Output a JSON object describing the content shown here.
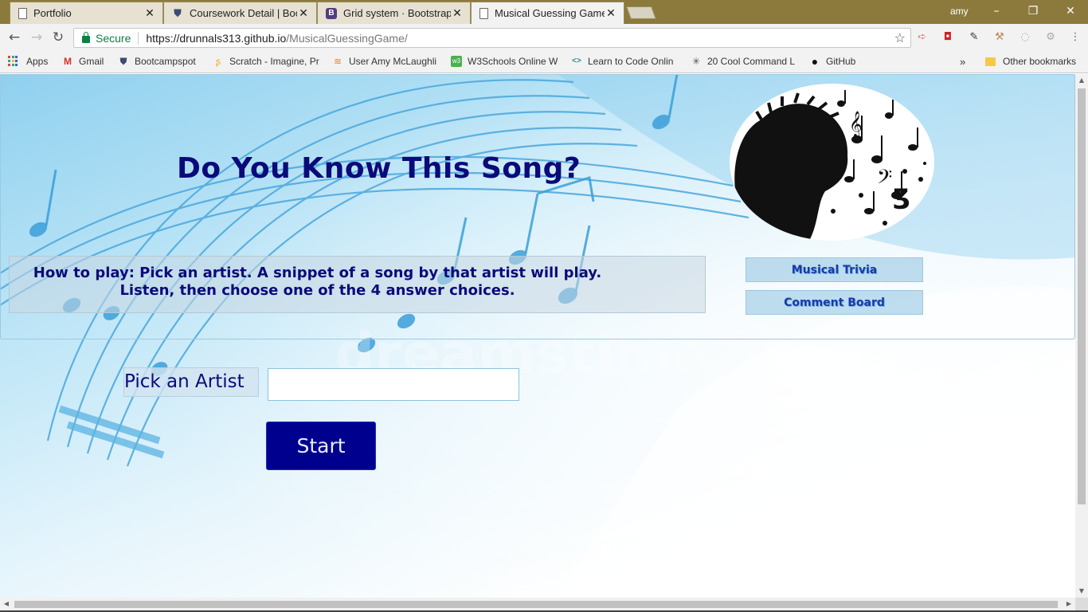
{
  "browser": {
    "tabs": [
      {
        "label": "Portfolio",
        "icon": "document-icon",
        "close": "✕"
      },
      {
        "label": "Coursework Detail | Boot",
        "icon": "bootcampspot-shield-icon",
        "close": "✕"
      },
      {
        "label": "Grid system · Bootstrap",
        "icon": "bootstrap-icon",
        "icon_text": "B",
        "close": "✕"
      },
      {
        "label": "Musical Guessing Game",
        "icon": "document-icon",
        "close": "✕"
      }
    ],
    "user": "amy",
    "address": {
      "secure_label": "Secure",
      "url_host": "https://drunnals313.github.io",
      "url_path": "/MusicalGuessingGame/"
    },
    "bookmarks": [
      {
        "label": "Apps",
        "icon": "apps-grid-icon"
      },
      {
        "label": "Gmail",
        "icon": "gmail-icon",
        "icon_text": "M"
      },
      {
        "label": "Bootcampspot",
        "icon": "shield-icon",
        "icon_text": "⛊"
      },
      {
        "label": "Scratch - Imagine, Pr",
        "icon": "scratch-icon",
        "icon_text": "ʂ"
      },
      {
        "label": "User Amy McLaughli",
        "icon": "stackoverflow-icon",
        "icon_text": "≋"
      },
      {
        "label": "W3Schools Online W",
        "icon": "w3schools-icon",
        "icon_text": "w3"
      },
      {
        "label": "Learn to Code Onlin",
        "icon": "code-icon",
        "icon_text": "<>"
      },
      {
        "label": "20 Cool Command L",
        "icon": "sparkle-icon",
        "icon_text": "✳"
      },
      {
        "label": "GitHub",
        "icon": "github-icon",
        "icon_text": "●"
      }
    ],
    "bookmarks_overflow": "»",
    "other_bookmarks": "Other bookmarks"
  },
  "page": {
    "title": "Do You Know This Song?",
    "howto_line1": "How to play: Pick an artist. A snippet of a song by that artist will play.",
    "howto_line2": "Listen, then choose one of the 4 answer choices.",
    "nav": {
      "trivia": "Musical Trivia",
      "comments": "Comment Board"
    },
    "pick_label": "Pick an Artist",
    "artist_value": "",
    "start_label": "Start"
  },
  "colors": {
    "title": "#0b0a7a",
    "start_button": "#00008f",
    "nav_text": "#1a3aa8"
  }
}
